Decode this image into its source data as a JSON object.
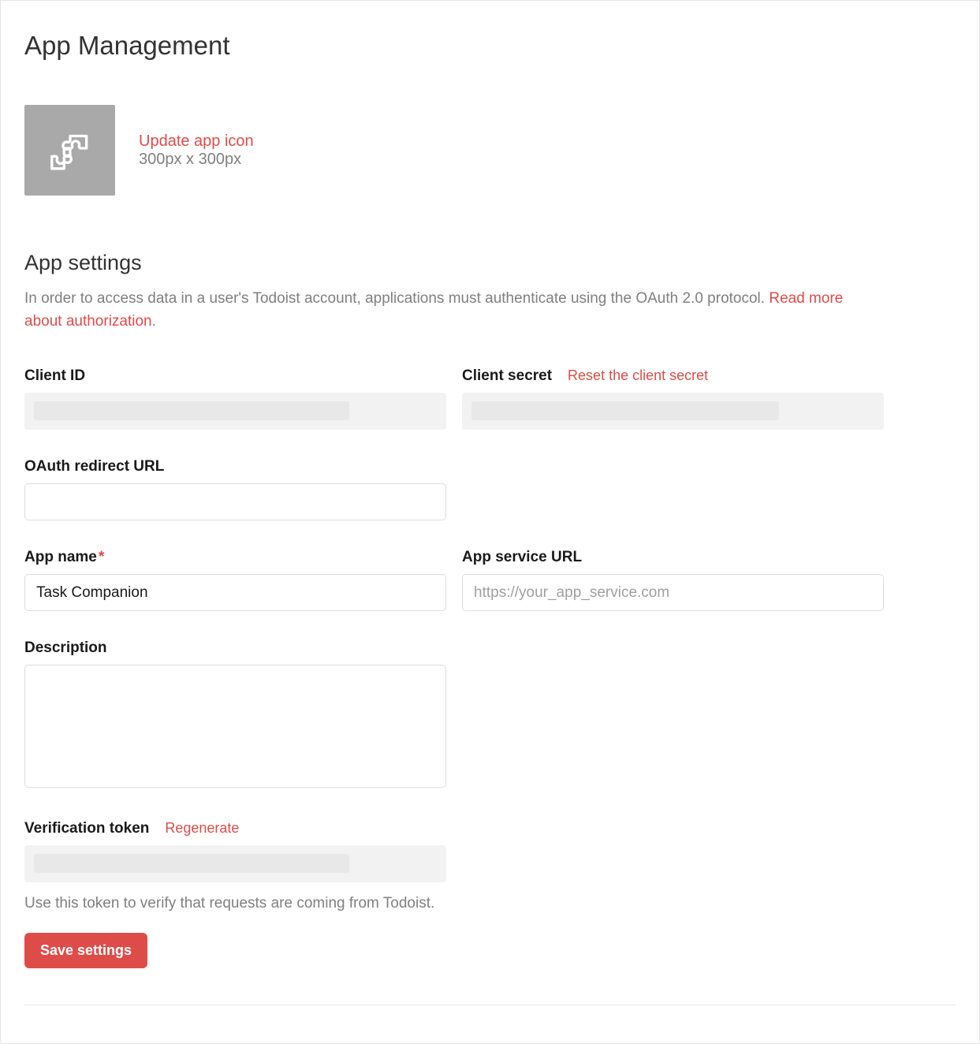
{
  "page": {
    "title": "App Management"
  },
  "icon": {
    "update_label": "Update app icon",
    "size_hint": "300px x 300px"
  },
  "settings": {
    "title": "App settings",
    "intro_prefix": "In order to access data in a user's Todoist account, applications must authenticate using the OAuth 2.0 protocol. ",
    "intro_link": "Read more about authorization",
    "intro_suffix": "."
  },
  "fields": {
    "client_id": {
      "label": "Client ID"
    },
    "client_secret": {
      "label": "Client secret",
      "reset_label": "Reset the client secret"
    },
    "oauth_redirect": {
      "label": "OAuth redirect URL",
      "value": ""
    },
    "app_name": {
      "label": "App name",
      "required_mark": "*",
      "value": "Task Companion"
    },
    "service_url": {
      "label": "App service URL",
      "value": "",
      "placeholder": "https://your_app_service.com"
    },
    "description": {
      "label": "Description",
      "value": ""
    },
    "verification_token": {
      "label": "Verification token",
      "regen_label": "Regenerate",
      "helper": "Use this token to verify that requests are coming from Todoist."
    }
  },
  "buttons": {
    "save": "Save settings"
  }
}
